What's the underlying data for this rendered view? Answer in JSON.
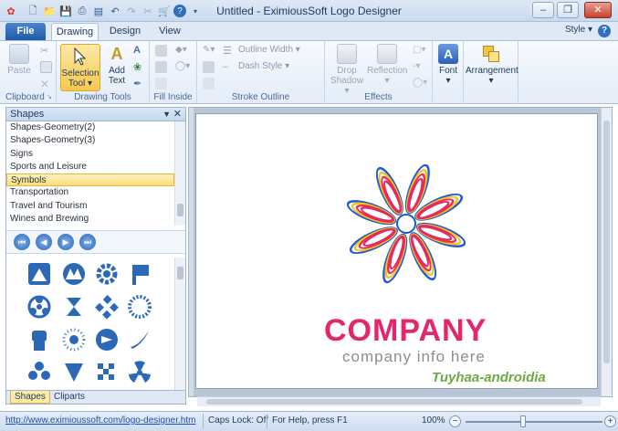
{
  "window": {
    "title": "Untitled - EximiousSoft Logo Designer"
  },
  "tabs": {
    "file": "File",
    "items": [
      "Drawing",
      "Design",
      "View"
    ],
    "style_label": "Style ▾"
  },
  "ribbon": {
    "clipboard": {
      "label": "Clipboard",
      "paste": "Paste"
    },
    "drawing_tools": {
      "label": "Drawing Tools",
      "selection_line1": "Selection",
      "selection_line2": "Tool ▾",
      "add_line1": "Add",
      "add_line2": "Text"
    },
    "fill_inside": {
      "label": "Fill Inside"
    },
    "stroke_outline": {
      "label": "Stroke Outline",
      "outline_width": "Outline Width ▾",
      "dash_style": "Dash Style ▾"
    },
    "effects": {
      "label": "Effects",
      "drop_line1": "Drop",
      "drop_line2": "Shadow ▾",
      "reflection_line1": "Reflection",
      "reflection_line2": "▾"
    },
    "font": {
      "label": "Font",
      "arrow": "▾"
    },
    "arrangement": {
      "label": "Arrangement",
      "arrow": "▾"
    }
  },
  "shapes_panel": {
    "title": "Shapes",
    "categories": [
      "Shapes-Geometry(2)",
      "Shapes-Geometry(3)",
      "Signs",
      "Sports and Leisure",
      "Symbols",
      "Transportation",
      "Travel and Tourism",
      "Wines and Brewing"
    ],
    "selected_category": "Symbols",
    "tabs": [
      "Shapes",
      "Cliparts"
    ]
  },
  "canvas": {
    "company_name": "COMPANY",
    "company_info": "company info here",
    "watermark": "Tuyhaa-androidia"
  },
  "status": {
    "url": "http://www.eximioussoft.com/logo-designer.htm",
    "caps_lock": "Caps Lock: Off",
    "help": "For Help, press F1",
    "zoom": "100%"
  },
  "colors": {
    "accent": "#2b5797",
    "selection": "#fbdd7c",
    "logo_pink": "#e2276b",
    "logo_blue": "#1b5bd1",
    "logo_yellow": "#f8c21c",
    "logo_red": "#e8304a"
  }
}
